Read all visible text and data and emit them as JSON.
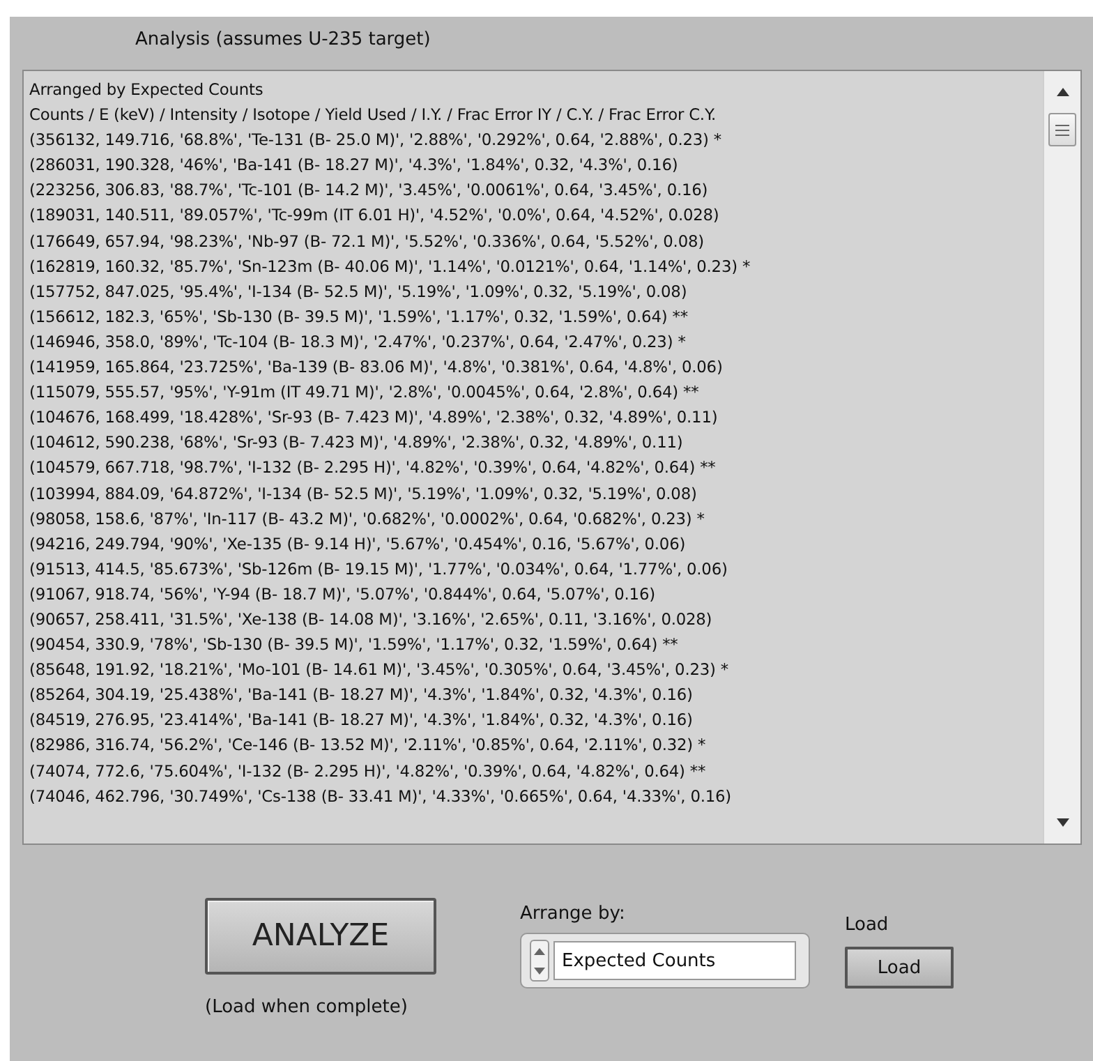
{
  "title": "Analysis (assumes U-235 target)",
  "results": {
    "lines": [
      "Arranged by Expected Counts",
      "Counts / E (keV) / Intensity / Isotope / Yield Used / I.Y. / Frac Error IY / C.Y. / Frac Error C.Y.",
      "(356132, 149.716, '68.8%', 'Te-131 (B- 25.0 M)', '2.88%', '0.292%', 0.64, '2.88%', 0.23) *",
      "(286031, 190.328, '46%', 'Ba-141 (B- 18.27 M)', '4.3%', '1.84%', 0.32, '4.3%', 0.16)",
      "(223256, 306.83, '88.7%', 'Tc-101 (B- 14.2 M)', '3.45%', '0.0061%', 0.64, '3.45%', 0.16)",
      "(189031, 140.511, '89.057%', 'Tc-99m (IT 6.01 H)', '4.52%', '0.0%', 0.64, '4.52%', 0.028)",
      "(176649, 657.94, '98.23%', 'Nb-97 (B- 72.1 M)', '5.52%', '0.336%', 0.64, '5.52%', 0.08)",
      "(162819, 160.32, '85.7%', 'Sn-123m (B- 40.06 M)', '1.14%', '0.0121%', 0.64, '1.14%', 0.23) *",
      "(157752, 847.025, '95.4%', 'I-134 (B- 52.5 M)', '5.19%', '1.09%', 0.32, '5.19%', 0.08)",
      "(156612, 182.3, '65%', 'Sb-130 (B- 39.5 M)', '1.59%', '1.17%', 0.32, '1.59%', 0.64) **",
      "(146946, 358.0, '89%', 'Tc-104 (B- 18.3 M)', '2.47%', '0.237%', 0.64, '2.47%', 0.23) *",
      "(141959, 165.864, '23.725%', 'Ba-139 (B- 83.06 M)', '4.8%', '0.381%', 0.64, '4.8%', 0.06)",
      "(115079, 555.57, '95%', 'Y-91m (IT 49.71 M)', '2.8%', '0.0045%', 0.64, '2.8%', 0.64) **",
      "(104676, 168.499, '18.428%', 'Sr-93 (B- 7.423 M)', '4.89%', '2.38%', 0.32, '4.89%', 0.11)",
      "(104612, 590.238, '68%', 'Sr-93 (B- 7.423 M)', '4.89%', '2.38%', 0.32, '4.89%', 0.11)",
      "(104579, 667.718, '98.7%', 'I-132 (B- 2.295 H)', '4.82%', '0.39%', 0.64, '4.82%', 0.64) **",
      "(103994, 884.09, '64.872%', 'I-134 (B- 52.5 M)', '5.19%', '1.09%', 0.32, '5.19%', 0.08)",
      "(98058, 158.6, '87%', 'In-117 (B- 43.2 M)', '0.682%', '0.0002%', 0.64, '0.682%', 0.23) *",
      "(94216, 249.794, '90%', 'Xe-135 (B- 9.14 H)', '5.67%', '0.454%', 0.16, '5.67%', 0.06)",
      "(91513, 414.5, '85.673%', 'Sb-126m (B- 19.15 M)', '1.77%', '0.034%', 0.64, '1.77%', 0.06)",
      "(91067, 918.74, '56%', 'Y-94 (B- 18.7 M)', '5.07%', '0.844%', 0.64, '5.07%', 0.16)",
      "(90657, 258.411, '31.5%', 'Xe-138 (B- 14.08 M)', '3.16%', '2.65%', 0.11, '3.16%', 0.028)",
      "(90454, 330.9, '78%', 'Sb-130 (B- 39.5 M)', '1.59%', '1.17%', 0.32, '1.59%', 0.64) **",
      "(85648, 191.92, '18.21%', 'Mo-101 (B- 14.61 M)', '3.45%', '0.305%', 0.64, '3.45%', 0.23) *",
      "(85264, 304.19, '25.438%', 'Ba-141 (B- 18.27 M)', '4.3%', '1.84%', 0.32, '4.3%', 0.16)",
      "(84519, 276.95, '23.414%', 'Ba-141 (B- 18.27 M)', '4.3%', '1.84%', 0.32, '4.3%', 0.16)",
      "(82986, 316.74, '56.2%', 'Ce-146 (B- 13.52 M)', '2.11%', '0.85%', 0.64, '2.11%', 0.32) *",
      "(74074, 772.6, '75.604%', 'I-132 (B- 2.295 H)', '4.82%', '0.39%', 0.64, '4.82%', 0.64) **",
      "(74046, 462.796, '30.749%', 'Cs-138 (B- 33.41 M)', '4.33%', '0.665%', 0.64, '4.33%', 0.16)"
    ]
  },
  "analyze": {
    "button": "ANALYZE",
    "note": "(Load when complete)"
  },
  "arrange": {
    "label": "Arrange by:",
    "value": "Expected Counts"
  },
  "load": {
    "label": "Load",
    "button": "Load"
  }
}
